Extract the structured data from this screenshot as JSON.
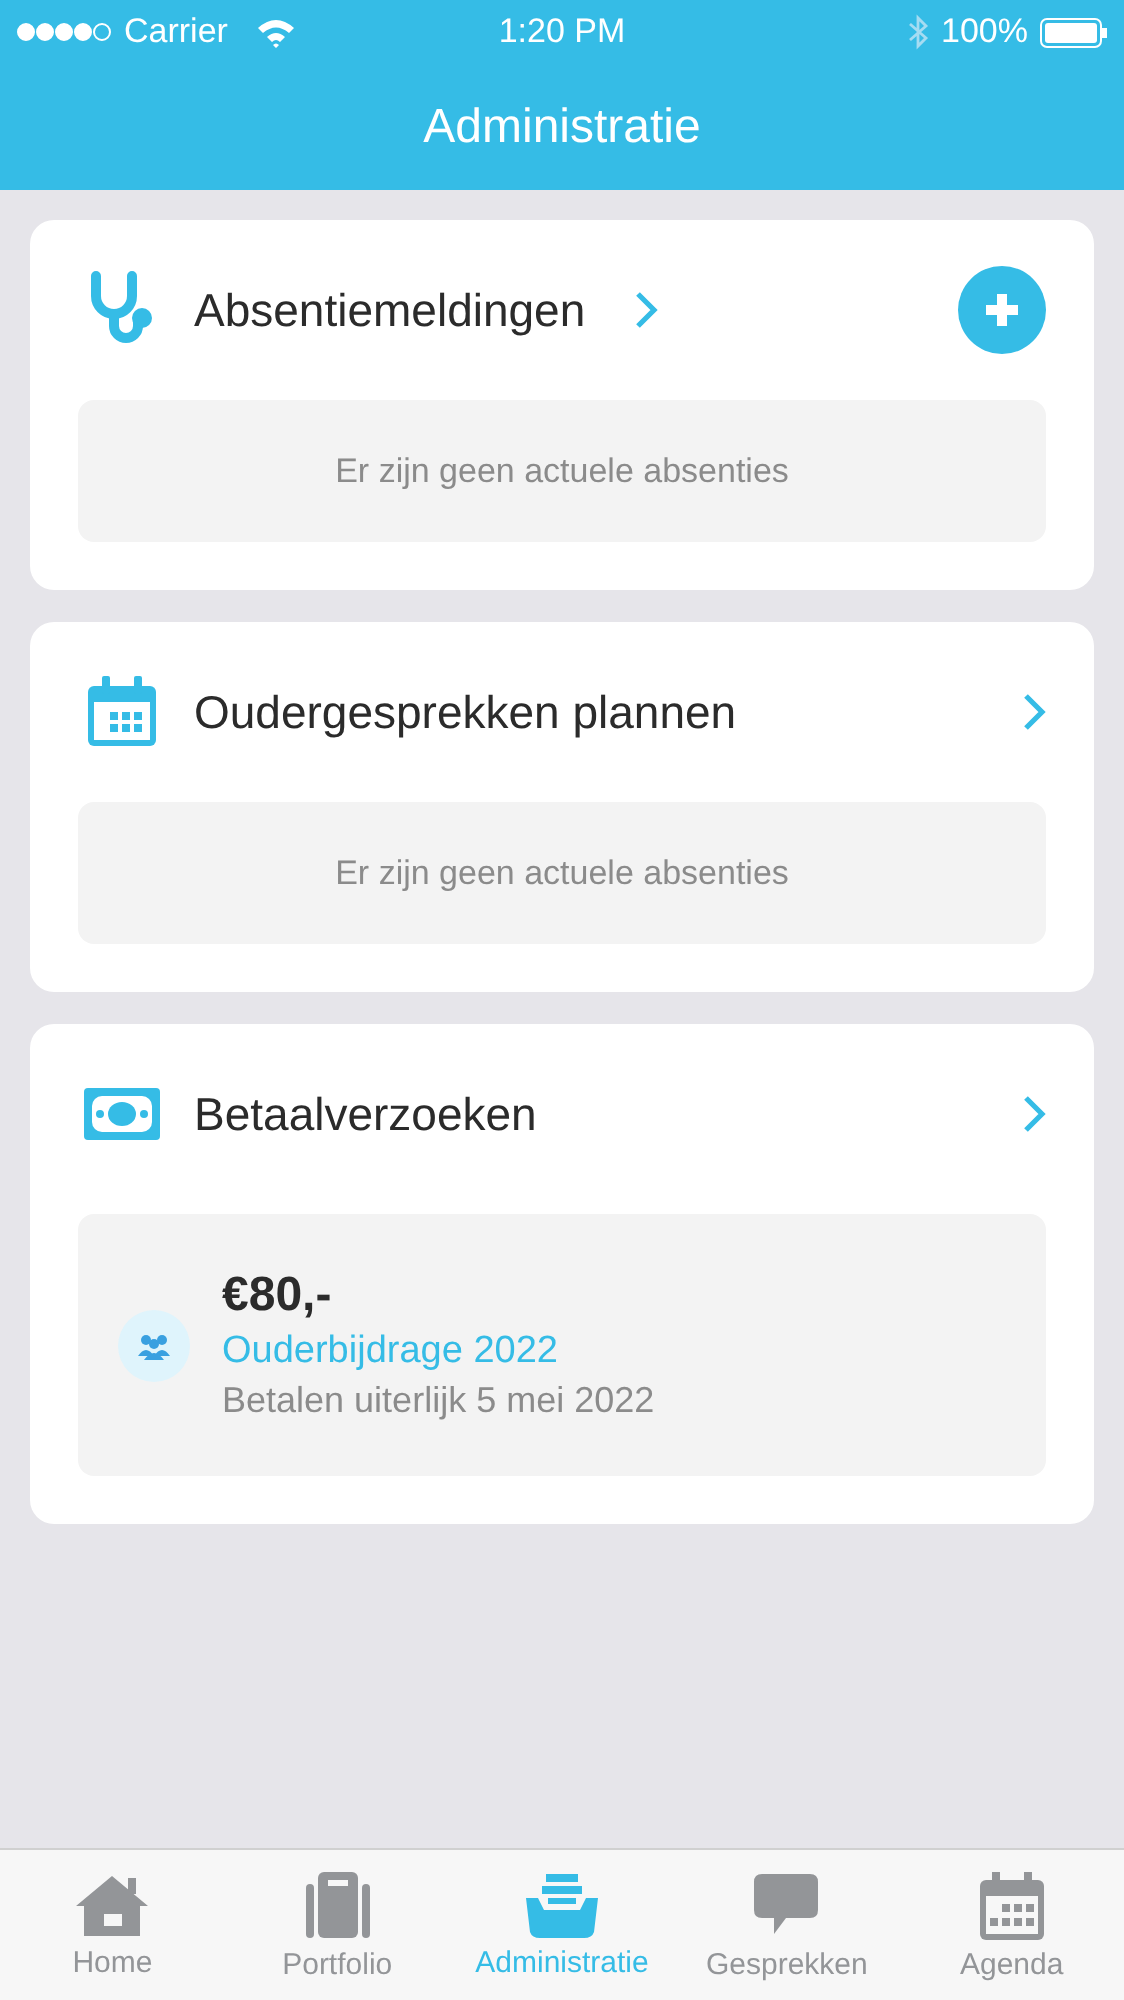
{
  "status_bar": {
    "carrier": "Carrier",
    "time": "1:20 PM",
    "battery": "100%"
  },
  "nav": {
    "title": "Administratie"
  },
  "cards": [
    {
      "kind": "empty",
      "title": "Absentiemeldingen",
      "add_button": true,
      "message": "Er zijn geen actuele absenties"
    },
    {
      "kind": "empty",
      "title": "Oudergesprekken plannen",
      "add_button": false,
      "message": "Er zijn geen actuele absenties"
    },
    {
      "kind": "payment",
      "title": "Betaalverzoeken",
      "add_button": false,
      "amount": "€80,-",
      "name": "Ouderbijdrage 2022",
      "due": "Betalen uiterlijk 5 mei 2022"
    }
  ],
  "tabs": [
    {
      "label": "Home",
      "selected": false
    },
    {
      "label": "Portfolio",
      "selected": false
    },
    {
      "label": "Administratie",
      "selected": true
    },
    {
      "label": "Gesprekken",
      "selected": false
    },
    {
      "label": "Agenda",
      "selected": false
    }
  ]
}
